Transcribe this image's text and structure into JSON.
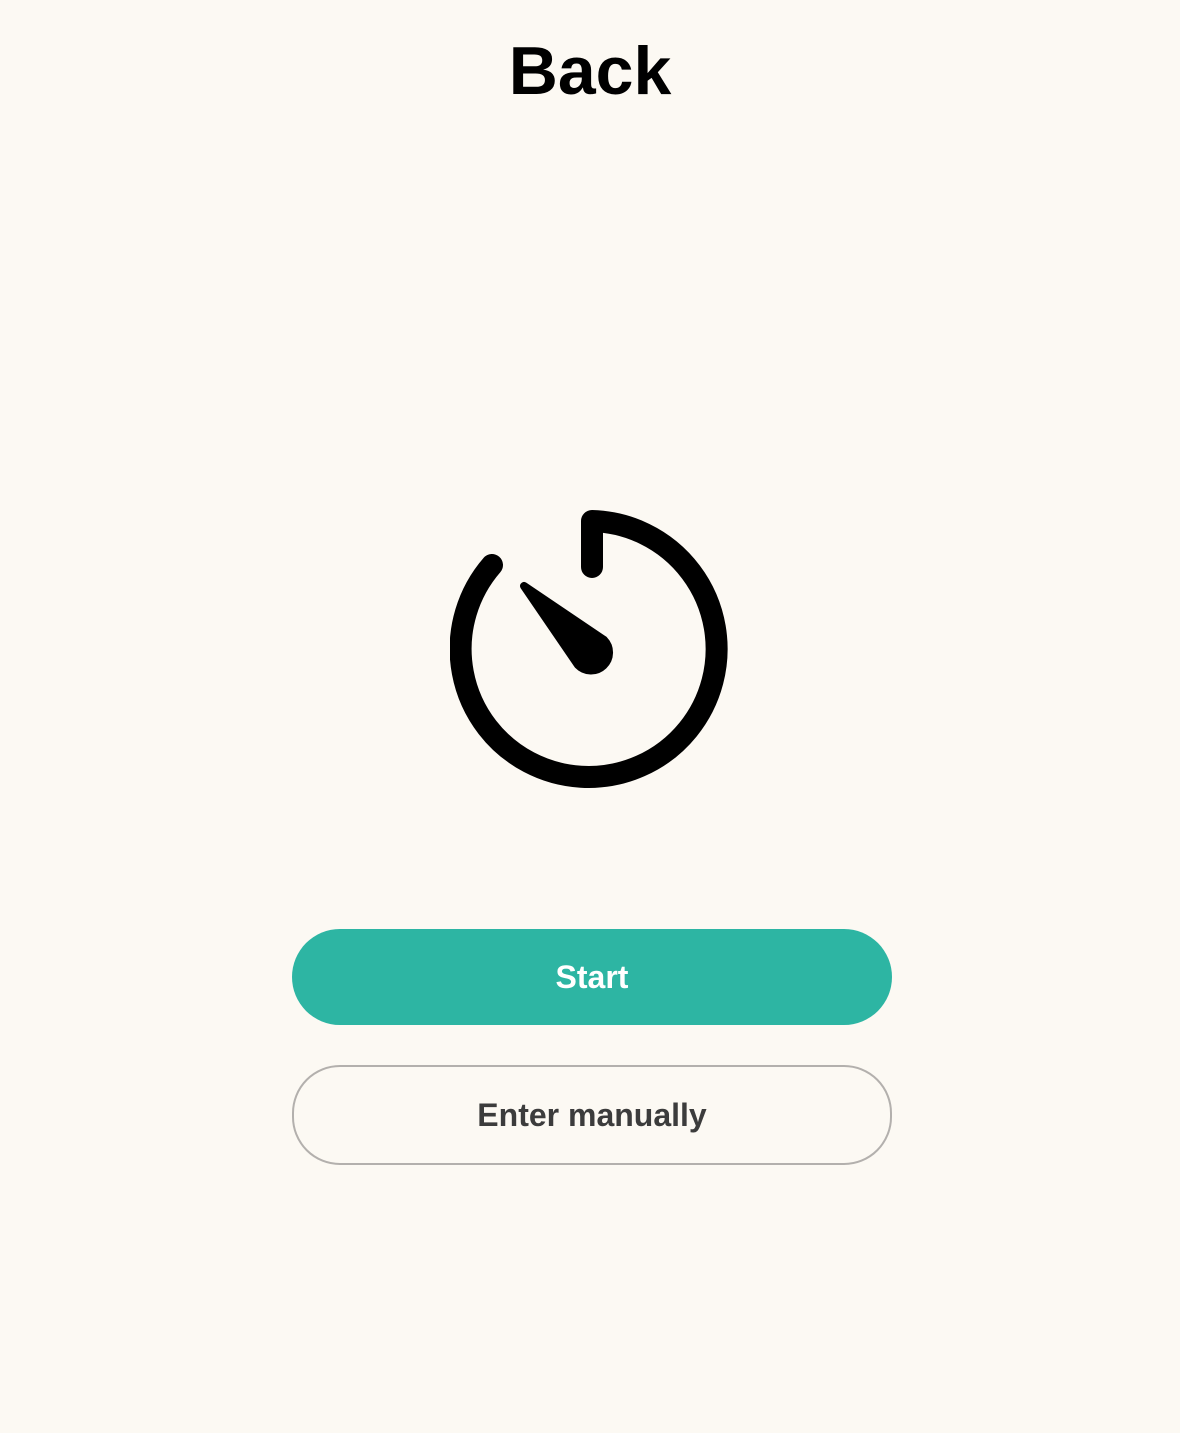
{
  "header": {
    "title": "Back"
  },
  "timer": {
    "icon": "stopwatch-icon"
  },
  "actions": {
    "start_label": "Start",
    "manual_label": "Enter manually"
  },
  "colors": {
    "background": "#fcf9f3",
    "accent": "#2db5a3",
    "text": "#000000",
    "secondary_text": "#3c3c3c",
    "outline": "#b3b0ad"
  }
}
